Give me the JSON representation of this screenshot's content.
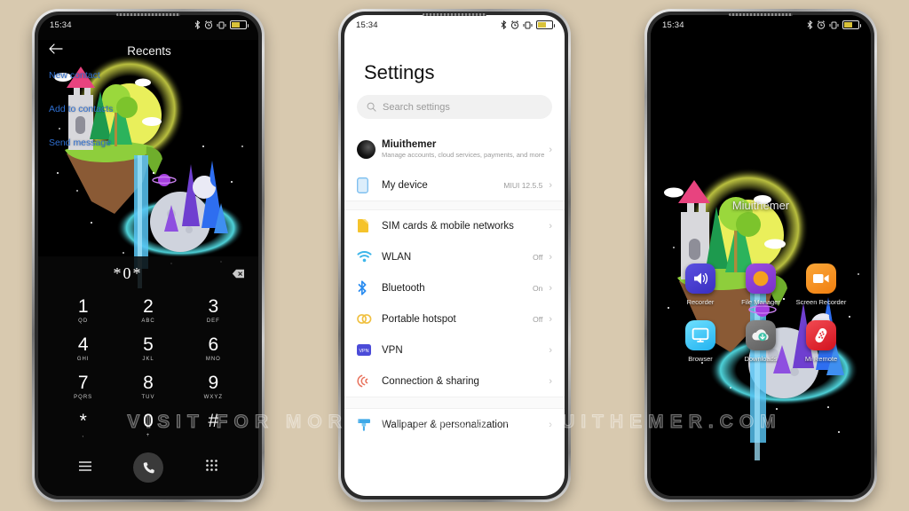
{
  "background_color": "#d8c9af",
  "watermark": "VISIT FOR MORE THEMES - MIUITHEMER.COM",
  "statusbar": {
    "time": "15:34"
  },
  "phone1": {
    "app_title": "Recents",
    "back_icon": "arrow-left-icon",
    "contact_actions": [
      "New contact",
      "Add to contacts",
      "Send message"
    ],
    "dialed_number": "*0*",
    "backspace_icon": "backspace-icon",
    "keys": [
      {
        "digit": "1",
        "letters": "QD"
      },
      {
        "digit": "2",
        "letters": "ABC"
      },
      {
        "digit": "3",
        "letters": "DEF"
      },
      {
        "digit": "4",
        "letters": "GHI"
      },
      {
        "digit": "5",
        "letters": "JKL"
      },
      {
        "digit": "6",
        "letters": "MNO"
      },
      {
        "digit": "7",
        "letters": "PQRS"
      },
      {
        "digit": "8",
        "letters": "TUV"
      },
      {
        "digit": "9",
        "letters": "WXYZ"
      },
      {
        "digit": "*",
        "letters": ","
      },
      {
        "digit": "0",
        "letters": "+"
      },
      {
        "digit": "#",
        "letters": ""
      }
    ],
    "bottom_bar": {
      "menu_icon": "menu-icon",
      "call_icon": "phone-call-icon",
      "keypad_icon": "keypad-grid-icon"
    },
    "accent_color": "#2f6fd0"
  },
  "phone2": {
    "title": "Settings",
    "search": {
      "placeholder": "Search settings",
      "icon": "search-icon"
    },
    "account": {
      "name": "Miuithemer",
      "subtitle": "Manage accounts, cloud services, payments, and more",
      "avatar_icon": "user-avatar"
    },
    "items": [
      {
        "label": "My device",
        "value": "MIUI 12.5.5",
        "icon": "phone-device-icon",
        "color": "#9ecbf0"
      },
      {
        "label": "SIM cards & mobile networks",
        "value": "",
        "icon": "sim-card-icon",
        "color": "#f6c744"
      },
      {
        "label": "WLAN",
        "value": "Off",
        "icon": "wifi-icon",
        "color": "#3fb5e8"
      },
      {
        "label": "Bluetooth",
        "value": "On",
        "icon": "bluetooth-icon",
        "color": "#2a8cf0"
      },
      {
        "label": "Portable hotspot",
        "value": "Off",
        "icon": "hotspot-icon",
        "color": "#f0c040"
      },
      {
        "label": "VPN",
        "value": "",
        "icon": "vpn-icon",
        "color": "#4b4bd8"
      },
      {
        "label": "Connection & sharing",
        "value": "",
        "icon": "connection-sharing-icon",
        "color": "#e8705a"
      },
      {
        "label": "Wallpaper & personalization",
        "value": "",
        "icon": "wallpaper-brush-icon",
        "color": "#3fa9e8"
      }
    ],
    "chevron": "›"
  },
  "phone3": {
    "folder_label": "Miuithemer",
    "apps": [
      {
        "name": "Recorder",
        "icon": "recorder-icon",
        "color": "#4b3fd4"
      },
      {
        "name": "File Manager",
        "icon": "file-manager-icon",
        "color": "#8a3fd4"
      },
      {
        "name": "Screen Recorder",
        "icon": "screen-recorder-icon",
        "color": "#f59320"
      },
      {
        "name": "Browser",
        "icon": "browser-icon",
        "color": "#3fc2f5"
      },
      {
        "name": "Downloads",
        "icon": "downloads-icon",
        "color": "#6e6e6e"
      },
      {
        "name": "Mi Remote",
        "icon": "mi-remote-icon",
        "color": "#e8303a"
      }
    ]
  }
}
